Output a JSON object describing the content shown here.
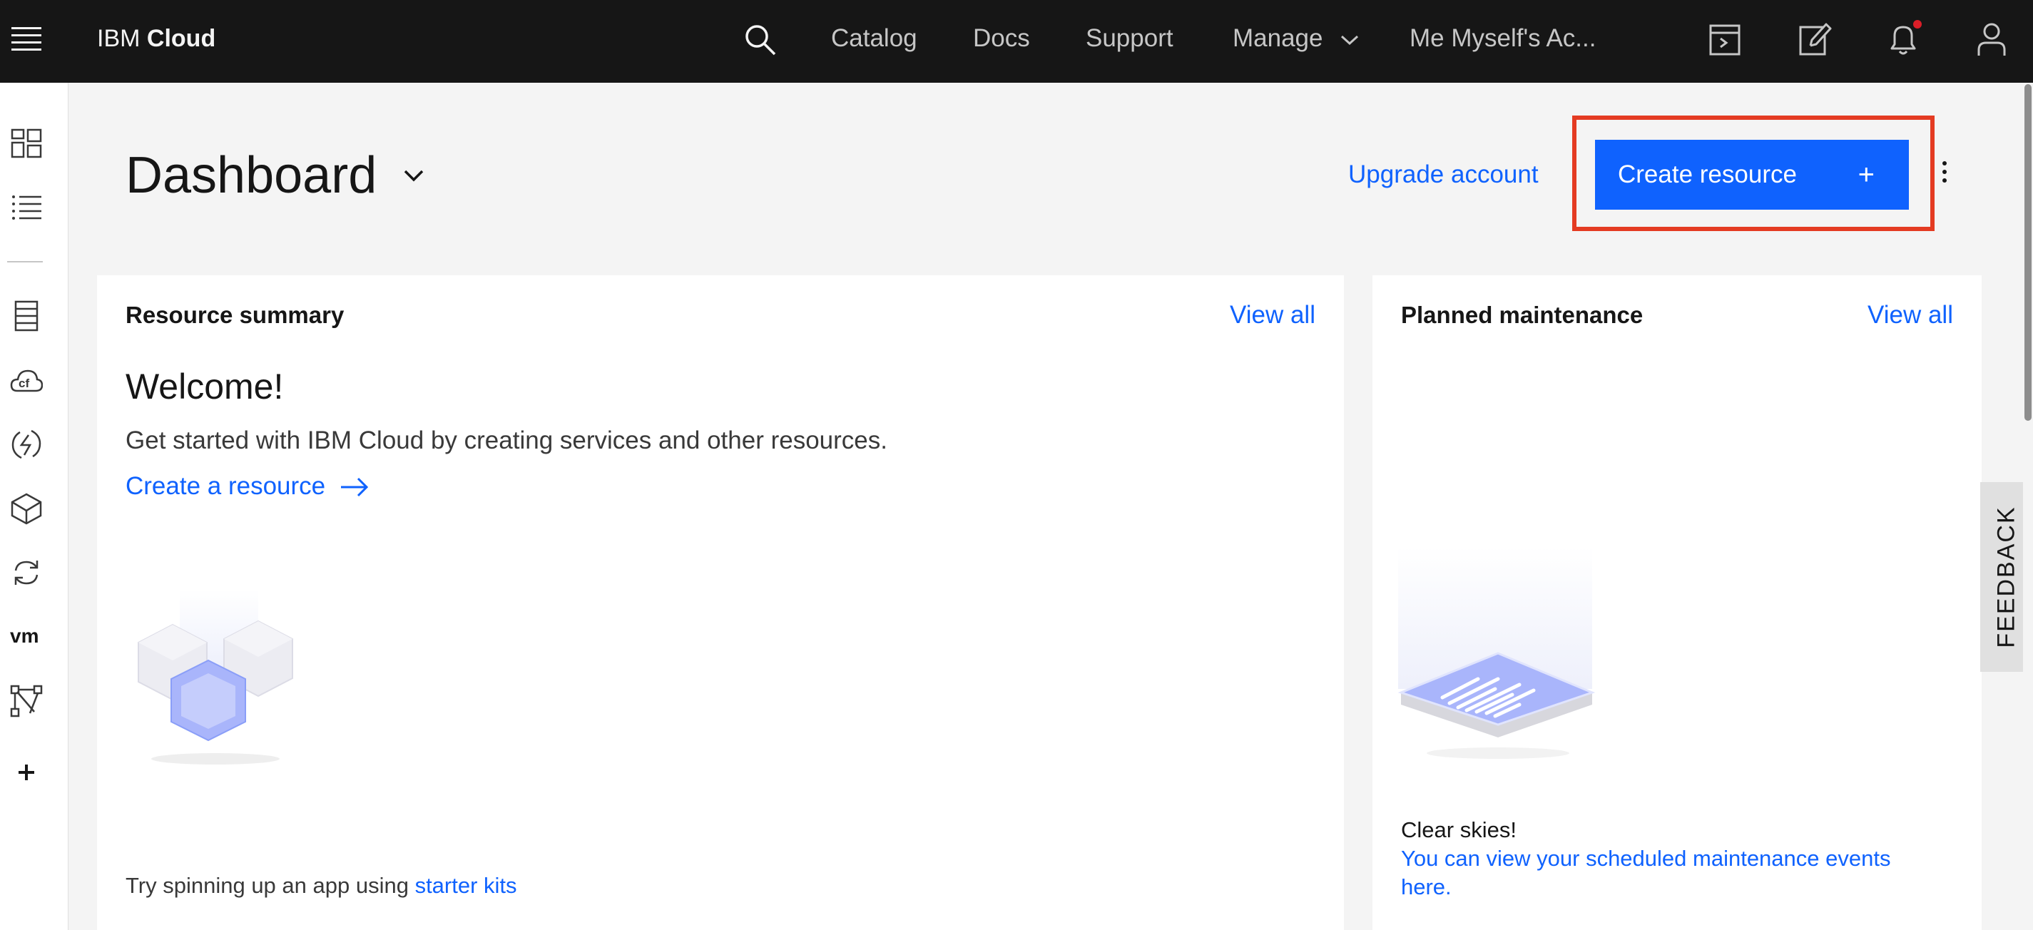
{
  "topbar": {
    "brand_prefix": "IBM",
    "brand_name": "Cloud",
    "nav": {
      "catalog": "Catalog",
      "docs": "Docs",
      "support": "Support",
      "manage": "Manage",
      "account": "Me Myself's Ac..."
    },
    "icons": [
      "menu-icon",
      "search-icon",
      "chevron-down-icon",
      "cost-estimator-icon",
      "edit-icon",
      "notification-icon",
      "user-icon"
    ],
    "notification_dot_color": "#da1e28"
  },
  "leftrail": {
    "icons": [
      "dashboard-icon",
      "resource-list-icon",
      "classic-infrastructure-icon",
      "cloud-foundry-icon",
      "functions-icon",
      "kubernetes-icon",
      "continuous-delivery-icon",
      "vmware-icon",
      "schematics-icon",
      "add-icon"
    ],
    "vm_label": "vm",
    "cf_label": "cf"
  },
  "header": {
    "title": "Dashboard",
    "upgrade_label": "Upgrade account",
    "create_label": "Create resource",
    "create_plus": "+"
  },
  "resource_summary": {
    "title": "Resource summary",
    "view_all": "View all",
    "welcome": "Welcome!",
    "description": "Get started with IBM Cloud by creating services and other resources.",
    "create_link": "Create a resource",
    "starter_prefix": "Try spinning up an app using ",
    "starter_link": "starter kits"
  },
  "planned_maintenance": {
    "title": "Planned maintenance",
    "view_all": "View all",
    "status": "Clear skies!",
    "link": "You can view your scheduled maintenance events here."
  },
  "feedback": {
    "label": "FEEDBACK"
  },
  "colors": {
    "topbar_bg": "#161616",
    "primary_button": "#0f62fe",
    "link": "#0f62fe",
    "highlight": "#e43b22",
    "page_bg": "#f4f4f4"
  }
}
